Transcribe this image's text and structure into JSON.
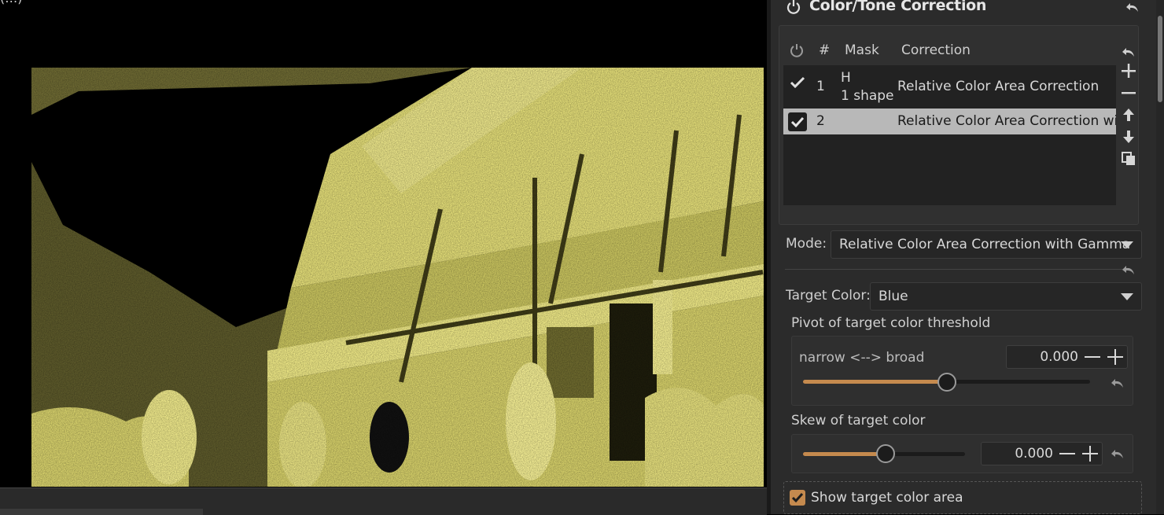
{
  "viewer": {
    "title_fragment": "(…)"
  },
  "panel": {
    "title": "Color/Tone Correction",
    "list": {
      "columns": [
        "#",
        "Mask",
        "Correction"
      ],
      "rows": [
        {
          "checked": true,
          "index": "1",
          "mask_line1": "H",
          "mask_line2": "1 shape",
          "correction": "Relative Color Area Correction",
          "selected": false
        },
        {
          "checked": true,
          "index": "2",
          "mask_line1": "",
          "mask_line2": "",
          "correction": "Relative Color Area Correction with",
          "selected": true
        }
      ]
    },
    "mode": {
      "label": "Mode:",
      "value": "Relative Color Area Correction with Gamma"
    },
    "target_color": {
      "label": "Target Color:",
      "value": "Blue"
    },
    "pivot": {
      "title": "Pivot of target color threshold",
      "slider_label": "narrow <--> broad",
      "value": "0.000",
      "position": 0.5
    },
    "skew": {
      "title": "Skew of target color",
      "value": "0.000",
      "position": 0.5
    },
    "show_target": {
      "label": "Show target color area",
      "checked": true
    }
  },
  "colors": {
    "accent": "#c58a4e",
    "photo_tint": "#e8e27a"
  }
}
